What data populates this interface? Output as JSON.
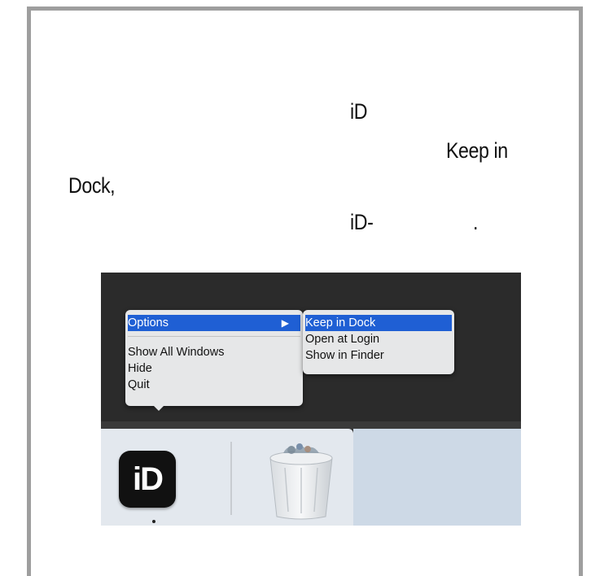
{
  "document": {
    "line1": "iD",
    "line2": "Keep in",
    "line3": "Dock,",
    "line4a": "iD-",
    "line4b": "."
  },
  "context_menu": {
    "items": [
      {
        "label": "Options",
        "submenu_arrow": "▶",
        "selected": true
      },
      {
        "label": "Show All Windows"
      },
      {
        "label": "Hide"
      },
      {
        "label": "Quit"
      }
    ]
  },
  "submenu": {
    "items": [
      {
        "label": "Keep in Dock",
        "selected": true
      },
      {
        "label": "Open at Login"
      },
      {
        "label": "Show in Finder"
      }
    ]
  },
  "dock": {
    "app_icon_text": "iD",
    "trash_icon": "trash-icon"
  },
  "colors": {
    "menu_selection": "#1f5fd4",
    "menu_bg": "#e6e7e8",
    "dark_bg": "#2b2b2b",
    "frame_border": "#9e9e9e"
  }
}
